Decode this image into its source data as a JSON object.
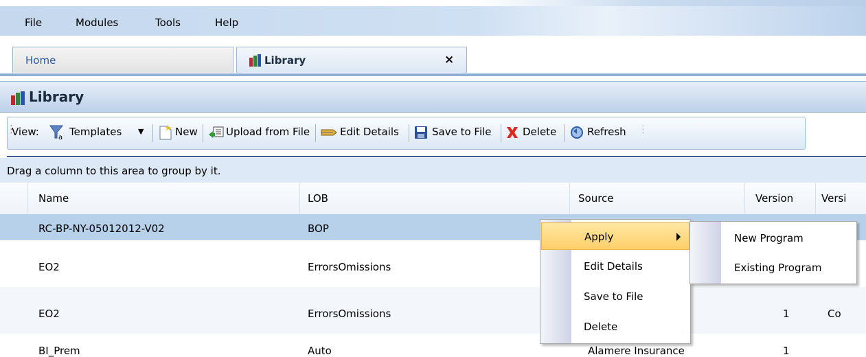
{
  "menu": {
    "file": "File",
    "modules": "Modules",
    "tools": "Tools",
    "help": "Help"
  },
  "tabs": {
    "home": "Home",
    "library": "Library",
    "close": "×"
  },
  "panel": {
    "title": "Library"
  },
  "toolbar": {
    "view_label": "View:",
    "templates": "Templates",
    "new": "New",
    "upload": "Upload from File",
    "edit_details": "Edit Details",
    "save_to_file": "Save to File",
    "delete": "Delete",
    "refresh": "Refresh"
  },
  "grid": {
    "group_hint": "Drag a column to this area to group by it.",
    "columns": {
      "name": "Name",
      "lob": "LOB",
      "source": "Source",
      "version": "Version",
      "version2": "Versi"
    },
    "rows": [
      {
        "name": "RC-BP-NY-05012012-V02",
        "lob": "BOP",
        "source": "",
        "version": "",
        "extra": ""
      },
      {
        "name": "EO2",
        "lob": "ErrorsOmissions",
        "source": "",
        "version": "",
        "extra": ""
      },
      {
        "name": "EO2",
        "lob": "ErrorsOmissions",
        "source": "",
        "version": "1",
        "extra": "Co"
      },
      {
        "name": "BI_Prem",
        "lob": "Auto",
        "source": "Alamere Insurance",
        "version": "1",
        "extra": ""
      }
    ]
  },
  "context_menu": {
    "apply": "Apply",
    "edit_details": "Edit Details",
    "save_to_file": "Save to File",
    "delete": "Delete"
  },
  "submenu": {
    "new_program": "New Program",
    "existing_program": "Existing Program"
  },
  "colors": {
    "selected_row": "#b8d1ea",
    "highlight": "#ffd27a",
    "header_blue": "#c5d8ee"
  }
}
